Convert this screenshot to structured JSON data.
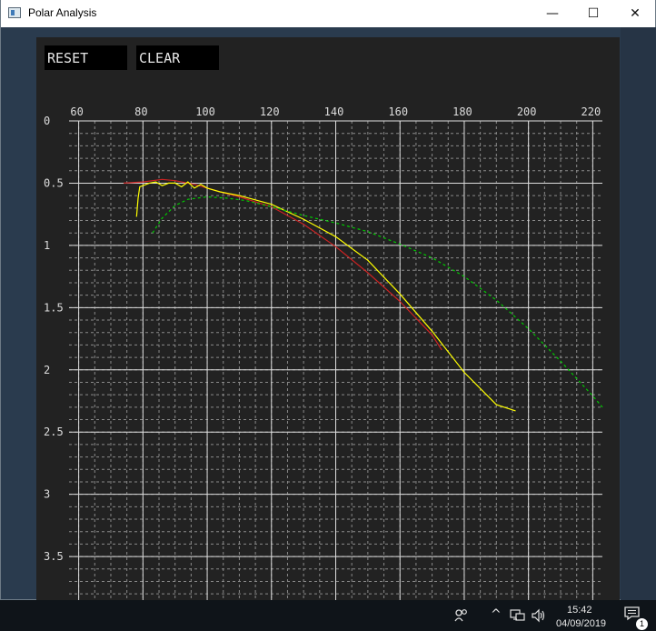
{
  "window": {
    "title": "Polar Analysis",
    "controls": {
      "minimize": "—",
      "maximize": "☐",
      "close": "✕"
    }
  },
  "toolbar": {
    "reset_label": "RESET",
    "clear_label": "CLEAR"
  },
  "chart_data": {
    "type": "line",
    "title": "",
    "xlabel": "",
    "ylabel": "",
    "xlim": [
      57,
      223
    ],
    "ylim": [
      0,
      3.85
    ],
    "y_inverted": true,
    "grid": true,
    "x_ticks": [
      60,
      80,
      100,
      120,
      140,
      160,
      180,
      200,
      220
    ],
    "y_ticks": [
      0,
      0.5,
      1,
      1.5,
      2,
      2.5,
      3,
      3.5
    ],
    "x_tick_labels": [
      "60",
      "80",
      "100",
      "120",
      "140",
      "160",
      "180",
      "200",
      "220"
    ],
    "y_tick_labels": [
      "0",
      "0.5",
      "1",
      "1.5",
      "2",
      "2.5",
      "3",
      "3.5"
    ],
    "series": [
      {
        "color": "#cc2222",
        "dash": "none",
        "x": [
          74,
          80,
          86,
          90,
          96,
          100,
          104,
          110,
          120,
          130,
          140,
          150,
          160,
          170,
          173
        ],
        "y": [
          0.5,
          0.49,
          0.47,
          0.48,
          0.51,
          0.54,
          0.57,
          0.61,
          0.69,
          0.83,
          1.01,
          1.22,
          1.45,
          1.72,
          1.84
        ]
      },
      {
        "color": "#ffff00",
        "dash": "none",
        "x": [
          78,
          78.5,
          79,
          80,
          82,
          84,
          86,
          88,
          90,
          92,
          94,
          96,
          98,
          100,
          104,
          110,
          120,
          130,
          140,
          150,
          160,
          170,
          180,
          190,
          196
        ],
        "y": [
          0.77,
          0.62,
          0.53,
          0.52,
          0.5,
          0.49,
          0.52,
          0.5,
          0.5,
          0.53,
          0.49,
          0.54,
          0.51,
          0.54,
          0.57,
          0.6,
          0.67,
          0.79,
          0.93,
          1.12,
          1.39,
          1.69,
          2.02,
          2.28,
          2.33
        ]
      },
      {
        "color": "#00cc00",
        "dash": "3,3",
        "x": [
          83,
          86,
          90,
          94,
          100,
          106,
          112,
          120,
          130,
          140,
          150,
          160,
          170,
          180,
          190,
          200,
          210,
          220,
          223
        ],
        "y": [
          0.9,
          0.78,
          0.68,
          0.63,
          0.61,
          0.62,
          0.64,
          0.69,
          0.76,
          0.82,
          0.89,
          0.99,
          1.1,
          1.25,
          1.44,
          1.67,
          1.93,
          2.21,
          2.3
        ]
      }
    ]
  },
  "taskbar": {
    "people_icon": "people-icon",
    "tray_chevron": "^",
    "network_icon": "network-icon",
    "volume_icon": "volume-icon",
    "time": "15:42",
    "date": "04/09/2019",
    "notifications_count": "1"
  }
}
